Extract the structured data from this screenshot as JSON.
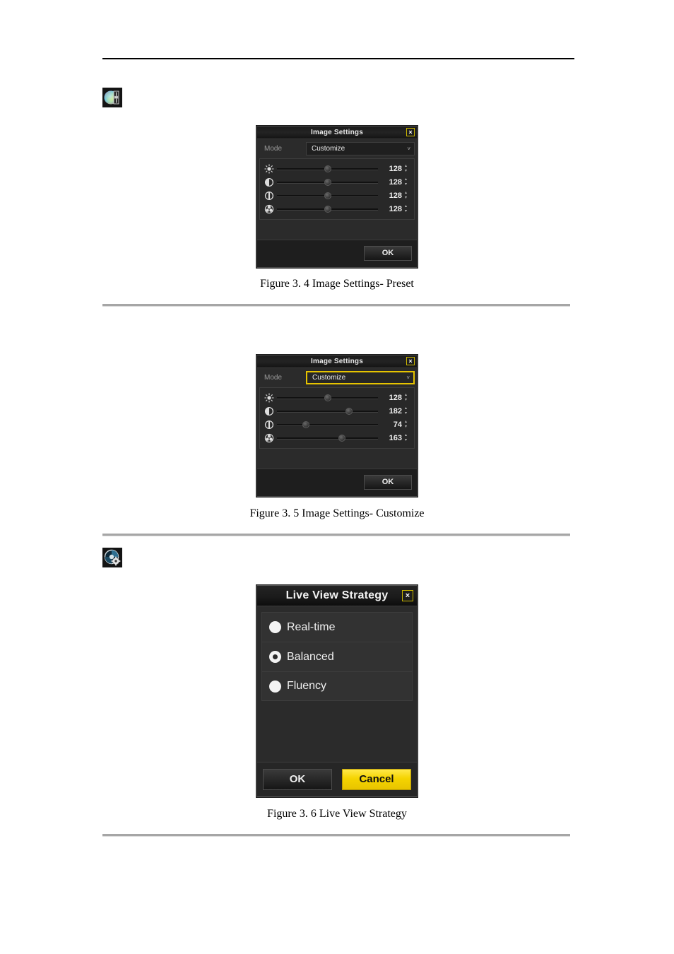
{
  "page": {
    "background": "#ffffff",
    "rule_color_top": "#000000",
    "rule_color_separator": "#a6a6a6"
  },
  "sections": [
    {
      "icon_name": "color-wheel-slider-icon",
      "icon_alt": "Image Settings icon"
    },
    {
      "icon_name": "aperture-gear-icon",
      "icon_alt": "Live View Strategy icon"
    }
  ],
  "captions": {
    "figure_3_4": "Figure 3. 4 Image Settings- Preset",
    "figure_3_5": "Figure 3. 5 Image Settings- Customize",
    "figure_3_6": "Figure 3. 6  Live View Strategy"
  },
  "dialog_preset": {
    "title": "Image Settings",
    "close_label": "×",
    "mode_label": "Mode",
    "mode_value": "Customize",
    "caret": "˅",
    "ok_label": "OK",
    "sliders": [
      {
        "icon": "brightness-icon",
        "value": "128",
        "percent": 50,
        "spinner": "⌃⌄"
      },
      {
        "icon": "contrast-icon",
        "value": "128",
        "percent": 50,
        "spinner": "⌃⌄"
      },
      {
        "icon": "saturation-icon",
        "value": "128",
        "percent": 50,
        "spinner": "⌃⌄"
      },
      {
        "icon": "hue-icon",
        "value": "128",
        "percent": 50,
        "spinner": "⌃⌄"
      }
    ]
  },
  "dialog_customize": {
    "title": "Image Settings",
    "close_label": "×",
    "mode_label": "Mode",
    "mode_value": "Customize",
    "mode_focused": true,
    "focus_color": "#e6c300",
    "caret": "˅",
    "ok_label": "OK",
    "sliders": [
      {
        "icon": "brightness-icon",
        "value": "128",
        "percent": 50,
        "spinner": "⌃⌄"
      },
      {
        "icon": "contrast-icon",
        "value": "182",
        "percent": 71,
        "spinner": "⌃⌄"
      },
      {
        "icon": "saturation-icon",
        "value": "74",
        "percent": 29,
        "spinner": "⌃⌄"
      },
      {
        "icon": "hue-icon",
        "value": "163",
        "percent": 64,
        "spinner": "⌃⌄"
      }
    ]
  },
  "dialog_strategy": {
    "title": "Live View Strategy",
    "close_label": "×",
    "options": [
      {
        "label": "Real-time",
        "selected": false
      },
      {
        "label": "Balanced",
        "selected": true
      },
      {
        "label": "Fluency",
        "selected": false
      }
    ],
    "ok_label": "OK",
    "cancel_label": "Cancel",
    "cancel_color": "#f5d400"
  }
}
